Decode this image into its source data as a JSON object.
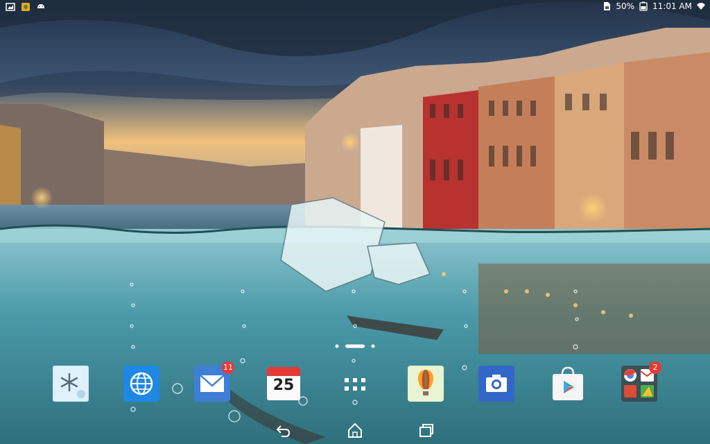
{
  "status_bar": {
    "battery": "50%",
    "time": "11:01 AM",
    "left_icons": [
      "gallery-notification-icon",
      "app-notification-icon",
      "android-notification-icon"
    ],
    "right_icons": [
      "sim-card-icon",
      "battery-icon",
      "wifi-icon"
    ]
  },
  "home": {
    "page_indicator": {
      "pages": 3,
      "current": 2
    },
    "apps": [
      {
        "name": "weather-widget-icon"
      },
      {
        "name": "browser-icon"
      },
      {
        "name": "email-icon",
        "badge": "11"
      },
      {
        "name": "calendar-icon",
        "date": "25"
      },
      {
        "name": "app-drawer-icon"
      },
      {
        "name": "balloon-app-icon"
      },
      {
        "name": "camera-icon"
      },
      {
        "name": "play-store-icon"
      },
      {
        "name": "google-folder-icon",
        "badge": "2"
      }
    ]
  },
  "nav_bar": {
    "buttons": [
      "back-icon",
      "home-icon",
      "recents-icon"
    ]
  },
  "colors": {
    "sky_top": "#2b3e57",
    "sunset": "#f3c27a",
    "water": "#3d8ea3",
    "accent_blue": "#1e88e5",
    "badge_red": "#e53935"
  }
}
